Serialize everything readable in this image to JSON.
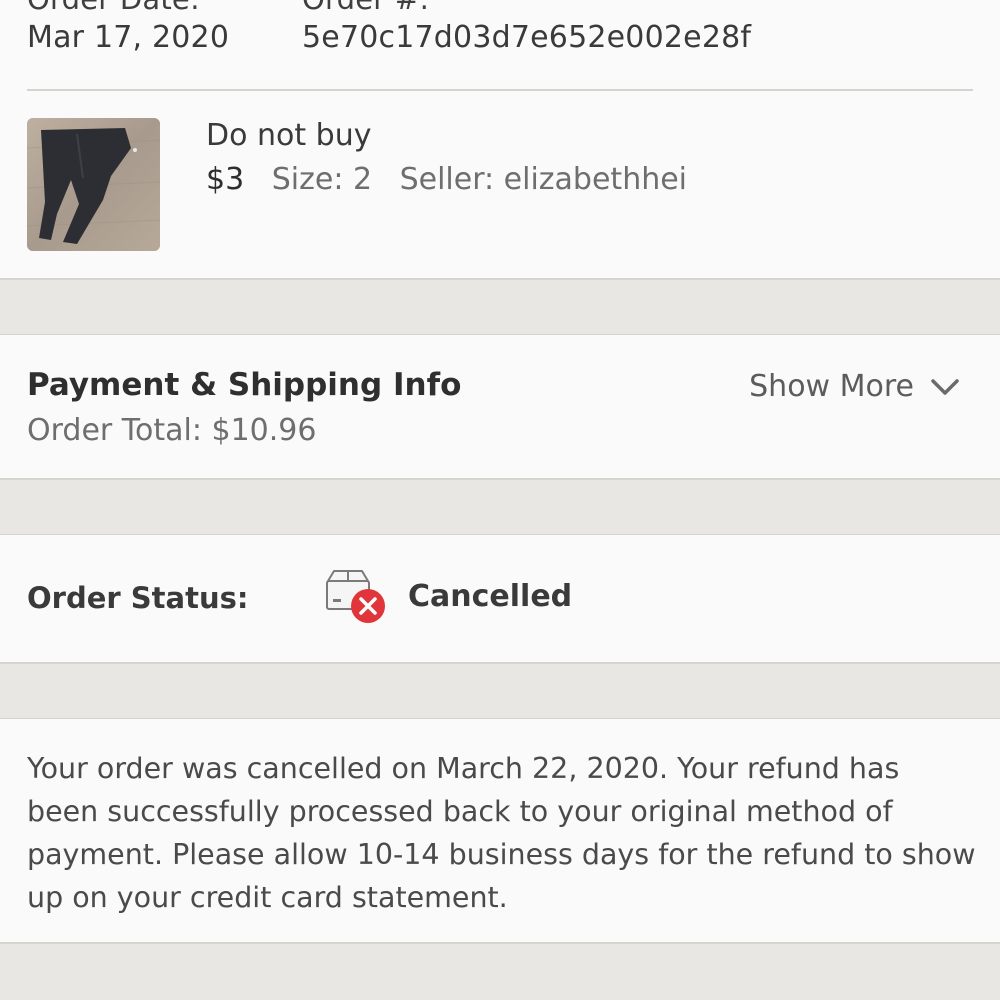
{
  "order": {
    "date_label": "Order Date:",
    "date_value": "Mar 17, 2020",
    "number_label": "Order #:",
    "number_value": "5e70c17d03d7e652e002e28f"
  },
  "item": {
    "title": "Do not buy",
    "price": "$3",
    "size": "Size: 2",
    "seller": "Seller: elizabethhei",
    "thumbnail_icon": "leggings-photo"
  },
  "payment": {
    "title": "Payment & Shipping Info",
    "total": "Order Total: $10.96",
    "show_more_label": "Show More",
    "show_more_icon": "chevron-down-icon"
  },
  "status": {
    "label": "Order Status:",
    "value": "Cancelled",
    "icon": "box-cancelled-icon",
    "badge_color": "#e0353b"
  },
  "message": {
    "text": "Your order was cancelled on March 22, 2020. Your refund has been successfully processed back to your original method of payment. Please allow 10-14 business days for the refund to show up on your credit card statement."
  }
}
